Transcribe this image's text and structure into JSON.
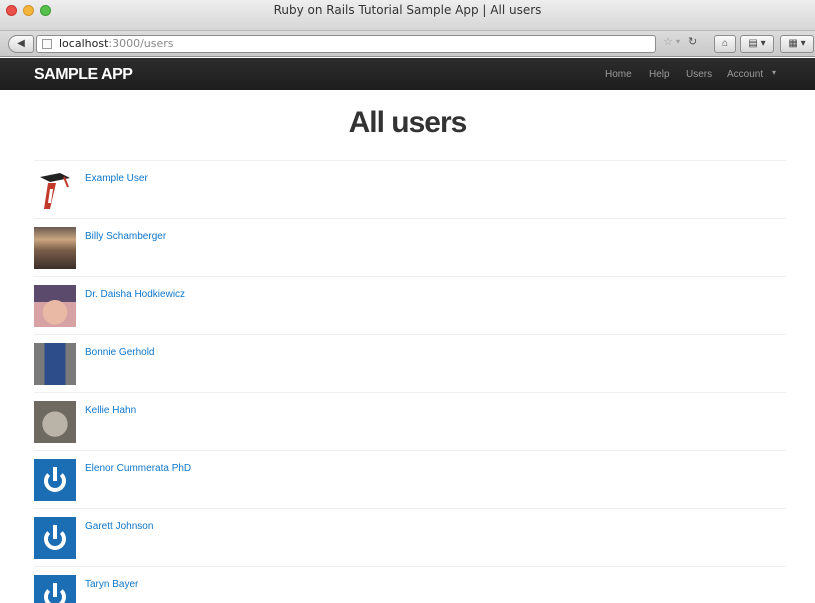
{
  "window": {
    "title": "Ruby on Rails Tutorial Sample App | All users"
  },
  "browser": {
    "url_host": "localhost",
    "url_path": ":3000/users"
  },
  "navbar": {
    "brand": "SAMPLE APP",
    "links": {
      "home": "Home",
      "help": "Help",
      "users": "Users",
      "account": "Account"
    }
  },
  "page": {
    "title": "All users"
  },
  "users": [
    {
      "name": "Example User",
      "avatar": "rails-logo-avatar"
    },
    {
      "name": "Billy Schamberger",
      "avatar": "sunset-photo-avatar"
    },
    {
      "name": "Dr. Daisha Hodkiewicz",
      "avatar": "baby-photo-avatar"
    },
    {
      "name": "Bonnie Gerhold",
      "avatar": "man-photo-avatar"
    },
    {
      "name": "Kellie Hahn",
      "avatar": "cat-photo-avatar"
    },
    {
      "name": "Elenor Cummerata PhD",
      "avatar": "power-icon-avatar"
    },
    {
      "name": "Garett Johnson",
      "avatar": "power-icon-avatar"
    },
    {
      "name": "Taryn Bayer",
      "avatar": "power-icon-avatar"
    }
  ],
  "colors": {
    "link": "#0e76c9",
    "navbar": "#222222",
    "gravatar_default": "#1b6eb4"
  }
}
